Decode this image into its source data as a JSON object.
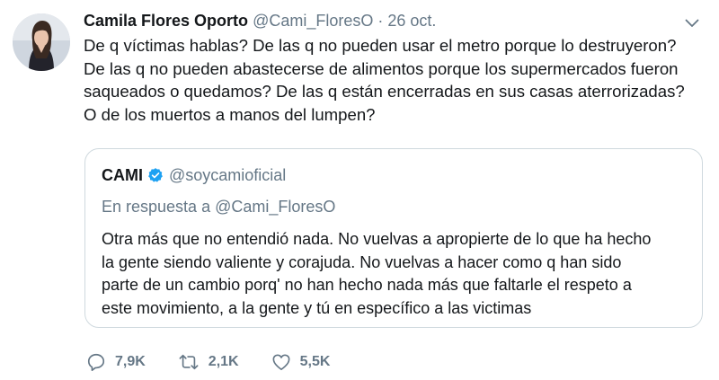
{
  "tweet": {
    "author_name": "Camila Flores Oporto",
    "author_handle": "@Cami_FloresO",
    "separator": "·",
    "date": "26 oct.",
    "lines": [
      "De q víctimas hablas? De las q no pueden usar el metro porque lo destruyeron?",
      "De las q no pueden abastecerse de alimentos porque los supermercados fueron",
      "saqueados o quedamos? De las q están encerradas en sus casas aterrorizadas?",
      "O de los muertos a manos del lumpen?"
    ]
  },
  "quote": {
    "author_name": "CAMI",
    "author_handle": "@soycamioficial",
    "reply_line": "En respuesta a @Cami_FloresO",
    "lines": [
      "Otra más que no entendió nada. No vuelvas a apropierte de lo que ha hecho",
      "la gente siendo valiente y corajuda. No vuelvas a hacer como q han sido",
      "parte de un cambio porq' no han hecho nada más que faltarle el respeto a",
      "este movimiento, a la gente y tú en específico a las victimas"
    ]
  },
  "actions": {
    "reply_count": "7,9K",
    "retweet_count": "2,1K",
    "like_count": "5,5K"
  },
  "icons": {
    "caret": "chevron-down-icon",
    "verified": "verified-badge-icon",
    "reply": "reply-icon",
    "retweet": "retweet-icon",
    "like": "heart-icon"
  },
  "colors": {
    "text": "#14171a",
    "secondary": "#657786",
    "verified": "#1da1f2",
    "border": "#cfd9de"
  }
}
